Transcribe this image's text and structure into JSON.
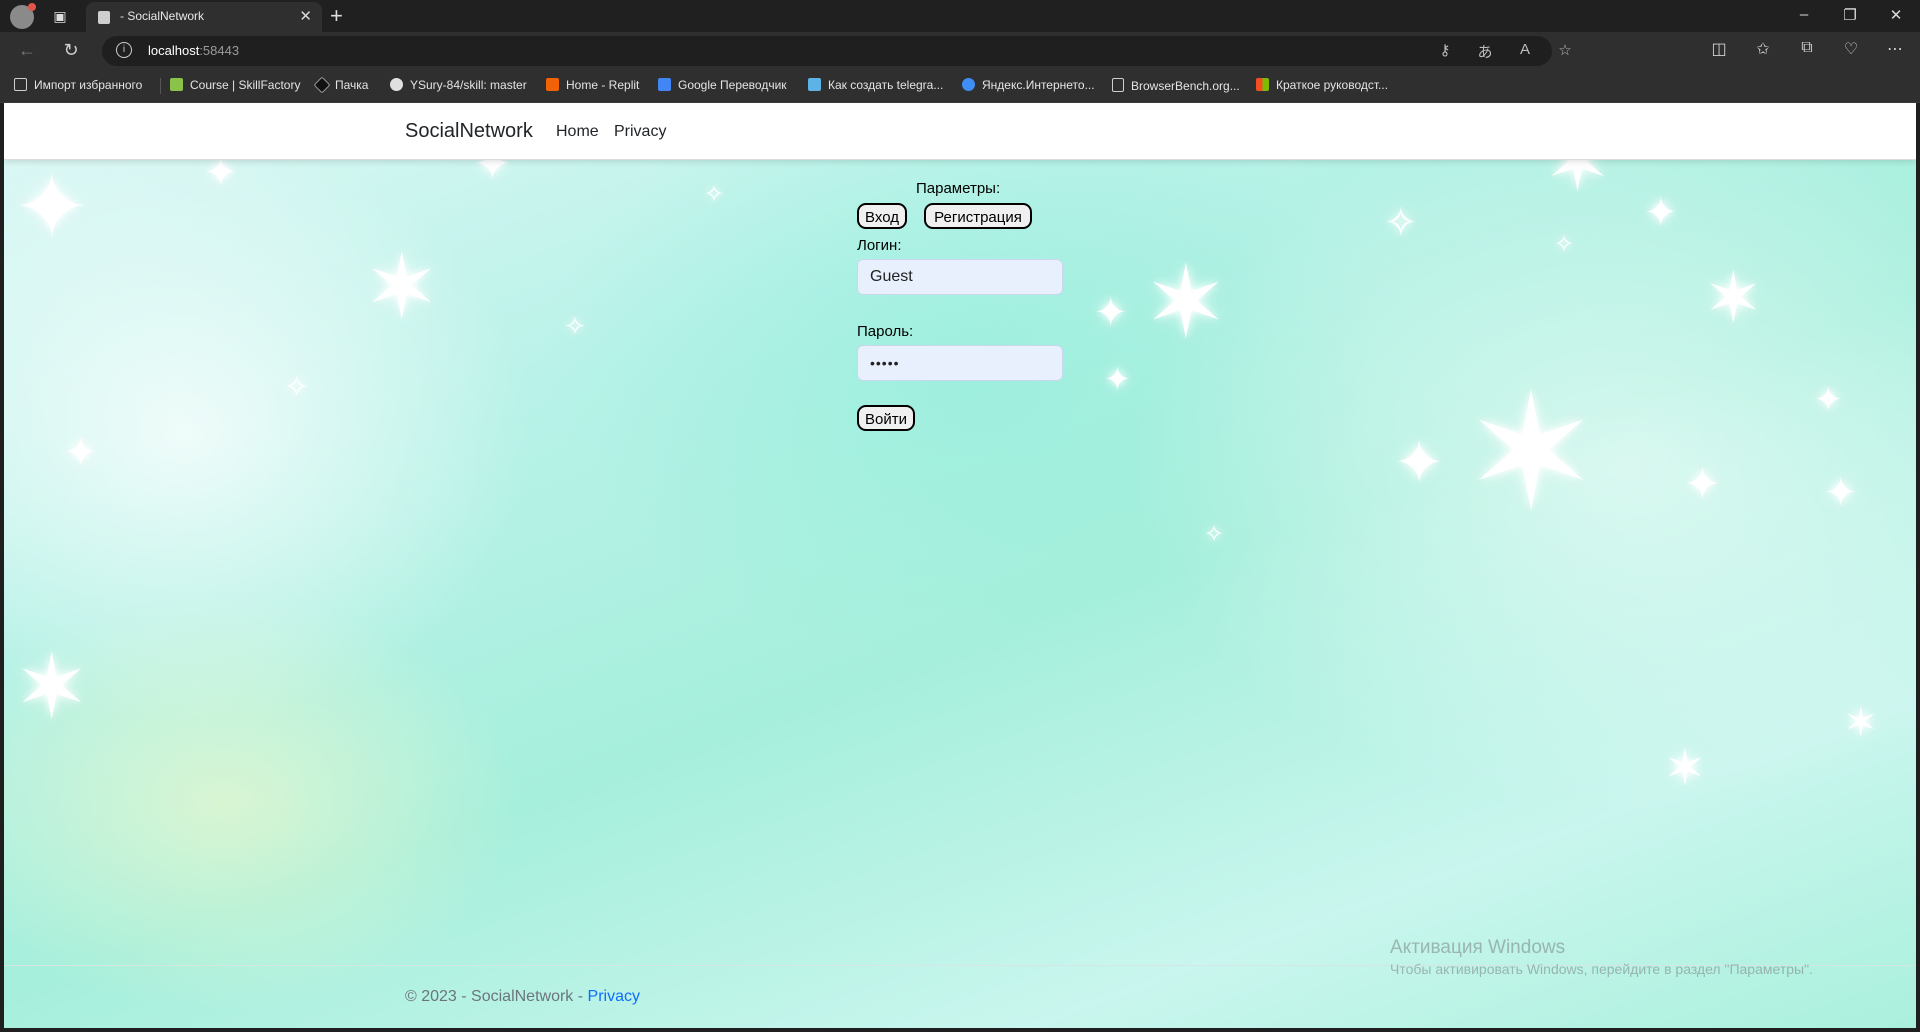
{
  "browser": {
    "tab_title": "- SocialNetwork",
    "url_host": "localhost",
    "url_port": ":58443",
    "bookmarks": [
      {
        "label": "Импорт избранного",
        "icon": "import-icon",
        "color": "#cfcfcf"
      },
      {
        "label": "Course | SkillFactory",
        "icon": "skillfactory-icon",
        "color": "#8bc34a"
      },
      {
        "label": "Пачка",
        "icon": "pachka-icon",
        "color": "#e0e0e0"
      },
      {
        "label": "YSury-84/skill: master",
        "icon": "github-icon",
        "color": "#e0e0e0"
      },
      {
        "label": "Home - Replit",
        "icon": "replit-icon",
        "color": "#f26207"
      },
      {
        "label": "Google Переводчик",
        "icon": "google-translate-icon",
        "color": "#4285f4"
      },
      {
        "label": "Как создать telegra...",
        "icon": "telegram-icon",
        "color": "#5db3e6"
      },
      {
        "label": "Яндекс.Интернето...",
        "icon": "yandex-icon",
        "color": "#3f8ef5"
      },
      {
        "label": "BrowserBench.org...",
        "icon": "page-icon",
        "color": "#cfcfcf"
      },
      {
        "label": "Краткое руководст...",
        "icon": "microsoft-icon",
        "color": "#f25022"
      }
    ]
  },
  "navbar": {
    "brand": "SocialNetwork",
    "links": [
      "Home",
      "Privacy"
    ]
  },
  "form": {
    "params_label": "Параметры:",
    "mode_buttons": [
      "Вход",
      "Регистрация"
    ],
    "login_label": "Логин:",
    "login_value": "Guest",
    "password_label": "Пароль:",
    "password_value": "•••••",
    "submit_label": "Войти"
  },
  "footer": {
    "text": "© 2023 - SocialNetwork - ",
    "link": "Privacy"
  },
  "watermark": {
    "title": "Активация Windows",
    "subtitle": "Чтобы активировать Windows, перейдите в раздел \"Параметры\"."
  }
}
